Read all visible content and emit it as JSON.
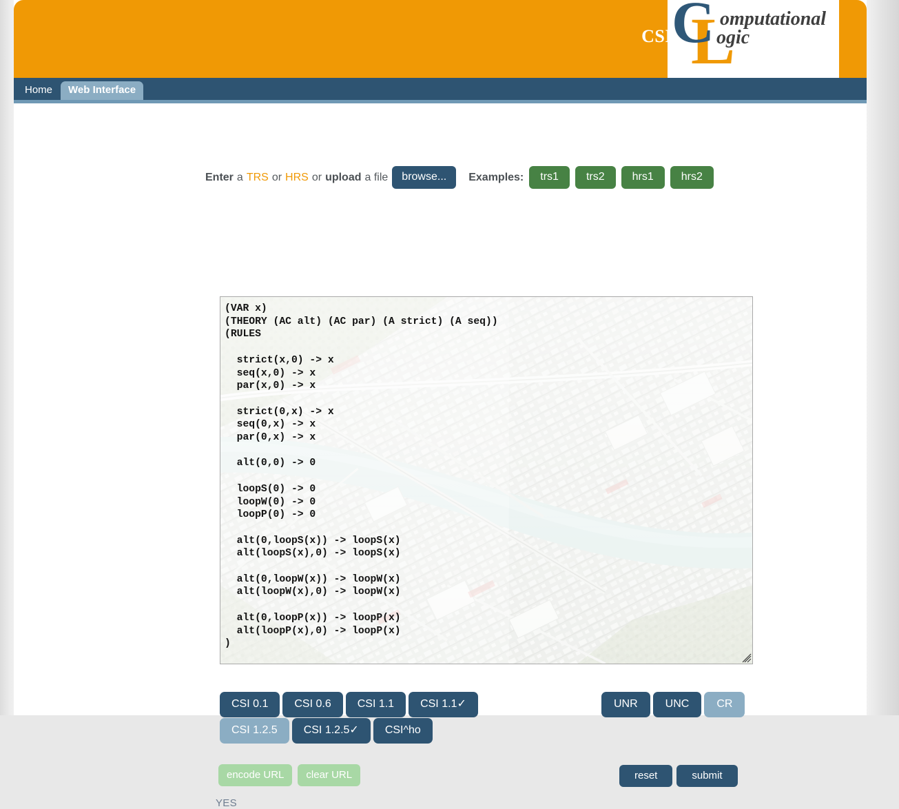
{
  "header": {
    "csi_label": "CSI",
    "logo": {
      "big_c": "C",
      "big_l": "L",
      "word1": "omputational",
      "word2": "ogic"
    },
    "colors": {
      "orange": "#f09905",
      "navy": "#2e5472",
      "steel": "#7099b5"
    }
  },
  "nav": {
    "items": [
      {
        "label": "Home",
        "active": false
      },
      {
        "label": "Web Interface",
        "active": true
      }
    ]
  },
  "form": {
    "prompt": {
      "enter": "Enter",
      "a1": "a",
      "trs": "TRS",
      "or1": "or",
      "hrs": "HRS",
      "or2": "or",
      "upload": "upload",
      "a2": "a file"
    },
    "browse_label": "browse...",
    "examples_label": "Examples:",
    "examples": [
      {
        "label": "trs1"
      },
      {
        "label": "trs2"
      },
      {
        "label": "hrs1"
      },
      {
        "label": "hrs2"
      }
    ],
    "textarea": {
      "value": "(VAR x)\n(THEORY (AC alt) (AC par) (A strict) (A seq))\n(RULES\n\n  strict(x,0) -> x\n  seq(x,0) -> x\n  par(x,0) -> x\n\n  strict(0,x) -> x\n  seq(0,x) -> x\n  par(0,x) -> x\n\n  alt(0,0) -> 0\n\n  loopS(0) -> 0\n  loopW(0) -> 0\n  loopP(0) -> 0\n\n  alt(0,loopS(x)) -> loopS(x)\n  alt(loopS(x),0) -> loopS(x)\n\n  alt(0,loopW(x)) -> loopW(x)\n  alt(loopW(x),0) -> loopW(x)\n\n  alt(0,loopP(x)) -> loopP(x)\n  alt(loopP(x),0) -> loopP(x)\n)",
      "placeholder": ""
    },
    "versions_row1": [
      {
        "label": "CSI 0.1",
        "selected": false
      },
      {
        "label": "CSI 0.6",
        "selected": false
      },
      {
        "label": "CSI 1.1",
        "selected": false
      },
      {
        "label": "CSI 1.1✓",
        "selected": false
      }
    ],
    "versions_row2": [
      {
        "label": "CSI 1.2.5",
        "selected": true
      },
      {
        "label": "CSI 1.2.5✓",
        "selected": false
      },
      {
        "label": "CSI^ho",
        "selected": false
      }
    ],
    "properties": [
      {
        "label": "UNR",
        "selected": false
      },
      {
        "label": "UNC",
        "selected": false
      },
      {
        "label": "CR",
        "selected": true
      }
    ],
    "url_buttons": [
      {
        "label": "encode URL"
      },
      {
        "label": "clear URL"
      }
    ],
    "action_buttons": [
      {
        "label": "reset"
      },
      {
        "label": "submit"
      }
    ],
    "result": "YES"
  }
}
